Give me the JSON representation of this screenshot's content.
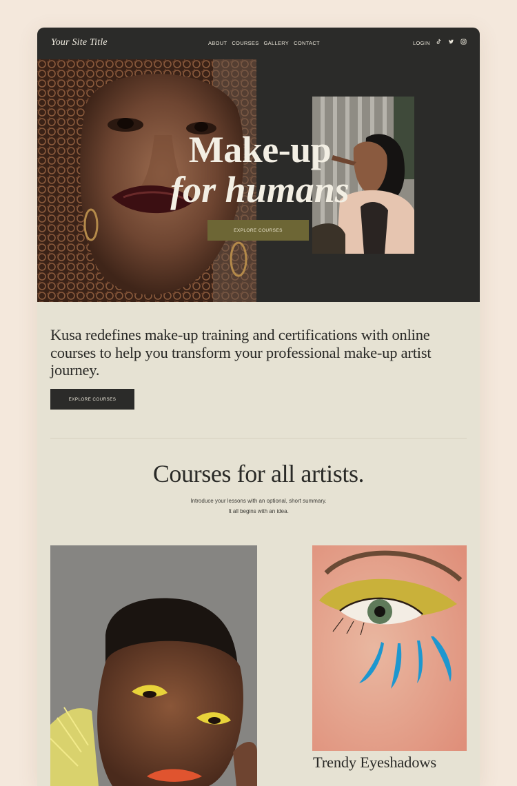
{
  "nav": {
    "site_title": "Your Site Title",
    "links": [
      "ABOUT",
      "COURSES",
      "GALLERY",
      "CONTACT"
    ],
    "login": "LOGIN",
    "social_icons": [
      "tiktok-icon",
      "twitter-icon",
      "instagram-icon"
    ]
  },
  "hero": {
    "title_line1": "Make-up",
    "title_line2": "for humans",
    "cta_label": "EXPLORE COURSES"
  },
  "intro": {
    "text": "Kusa redefines make-up training and certifications with online courses to help you transform your professional make-up artist journey.",
    "cta_label": "EXPLORE COURSES"
  },
  "courses": {
    "title": "Courses for all artists.",
    "subtitle": "Introduce your lessons with an optional, short summary. It all begins with an idea.",
    "items": [
      {
        "title": ""
      },
      {
        "title": "Trendy Eyeshadows"
      }
    ]
  },
  "colors": {
    "page_bg": "#f4e8dc",
    "panel_bg": "#e6e2d3",
    "dark": "#2b2b29",
    "olive_button": "#6d6635",
    "text_light": "#f3efe4"
  }
}
